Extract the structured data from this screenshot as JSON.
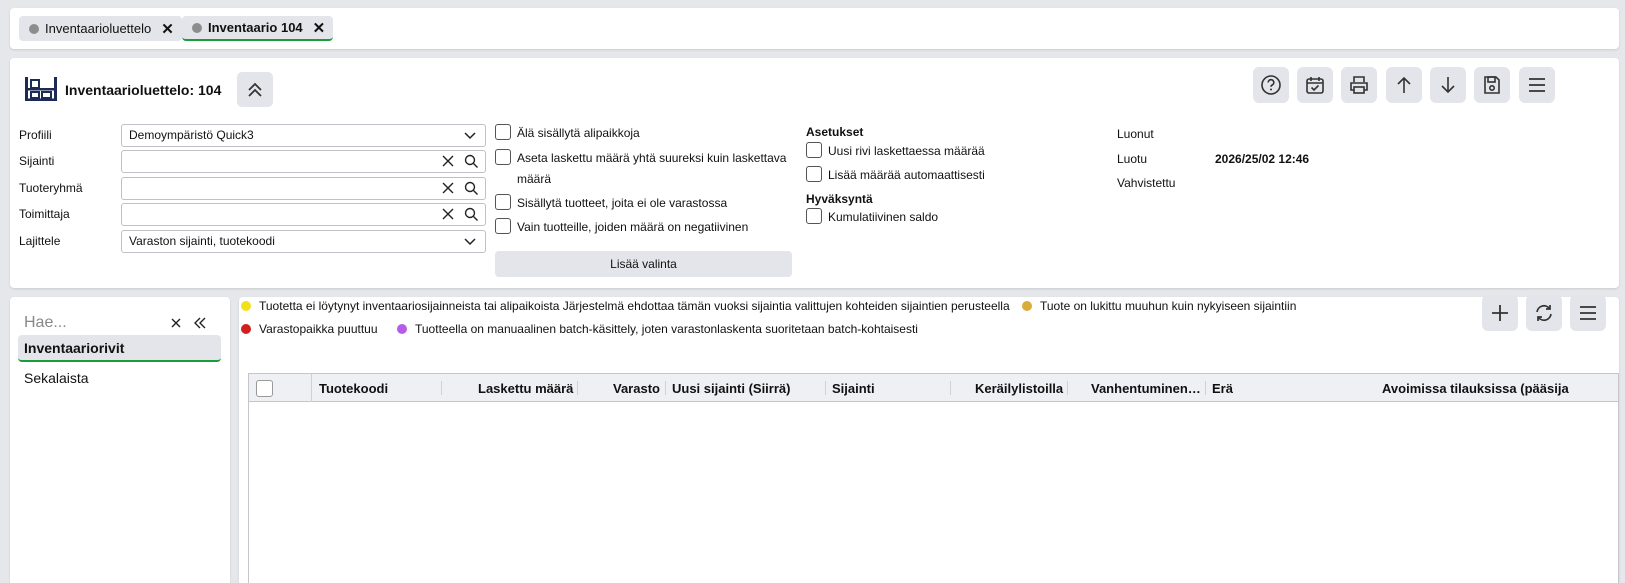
{
  "tabs": [
    {
      "label": "Inventaarioluettelo",
      "close": "✕"
    },
    {
      "label": "Inventaario 104",
      "close": "✕"
    }
  ],
  "header": {
    "title": "Inventaarioluettelo: 104",
    "toolbar_icons": [
      "help-icon",
      "calendar-check-icon",
      "print-icon",
      "arrow-up-icon",
      "arrow-down-icon",
      "save-icon",
      "menu-icon"
    ]
  },
  "filters": {
    "profile": {
      "label": "Profiili",
      "value": "Demoympäristö Quick3"
    },
    "location": {
      "label": "Sijainti",
      "value": ""
    },
    "product_group": {
      "label": "Tuoteryhmä",
      "value": ""
    },
    "supplier": {
      "label": "Toimittaja",
      "value": ""
    },
    "sort": {
      "label": "Lajittele",
      "value": "Varaston sijainti, tuotekoodi"
    }
  },
  "options": {
    "no_sublocations": "Älä sisällytä alipaikkoja",
    "set_counted_line1": "Aseta laskettu määrä yhtä suureksi kuin laskettava",
    "set_counted_line2": "määrä",
    "include_not_in_stock": "Sisällytä tuotteet, joita ei ole varastossa",
    "only_negative": "Vain tuotteille, joiden määrä on negatiivinen",
    "add_selection": "Lisää valinta"
  },
  "settings": {
    "heading": "Asetukset",
    "new_row": "Uusi rivi laskettaessa määrää",
    "add_auto": "Lisää määrää automaattisesti",
    "approval_heading": "Hyväksyntä",
    "cumulative": "Kumulatiivinen saldo"
  },
  "info": {
    "created_by_label": "Luonut",
    "created_label": "Luotu",
    "created_value": "2026/25/02 12:46",
    "confirmed_label": "Vahvistettu"
  },
  "sidebar": {
    "search_placeholder": "Hae...",
    "items": [
      {
        "label": "Inventaariorivit",
        "active": true
      },
      {
        "label": "Sekalaista",
        "active": false
      }
    ]
  },
  "legend": [
    {
      "color": "#f2e01a",
      "text": "Tuotetta ei löytynyt inventaariosijainneista tai alipaikoista Järjestelmä ehdottaa tämän vuoksi sijaintia valittujen kohteiden sijaintien perusteella"
    },
    {
      "color": "#d9ab3a",
      "text": "Tuote on lukittu muuhun kuin nykyiseen sijaintiin"
    },
    {
      "color": "#d21f1f",
      "text": "Varastopaikka puuttuu"
    },
    {
      "color": "#b65ce6",
      "text": "Tuotteella on manuaalinen batch-käsittely, joten varastonlaskenta suoritetaan batch-kohtaisesti"
    }
  ],
  "grid": {
    "columns": [
      "Tuotekoodi",
      "Laskettu määrä",
      "Varasto",
      "Uusi sijainti (Siirrä)",
      "Sijainti",
      "Keräilylistoilla",
      "Vanhentuminen…",
      "Erä",
      "Avoimissa tilauksissa (pääsija"
    ]
  }
}
